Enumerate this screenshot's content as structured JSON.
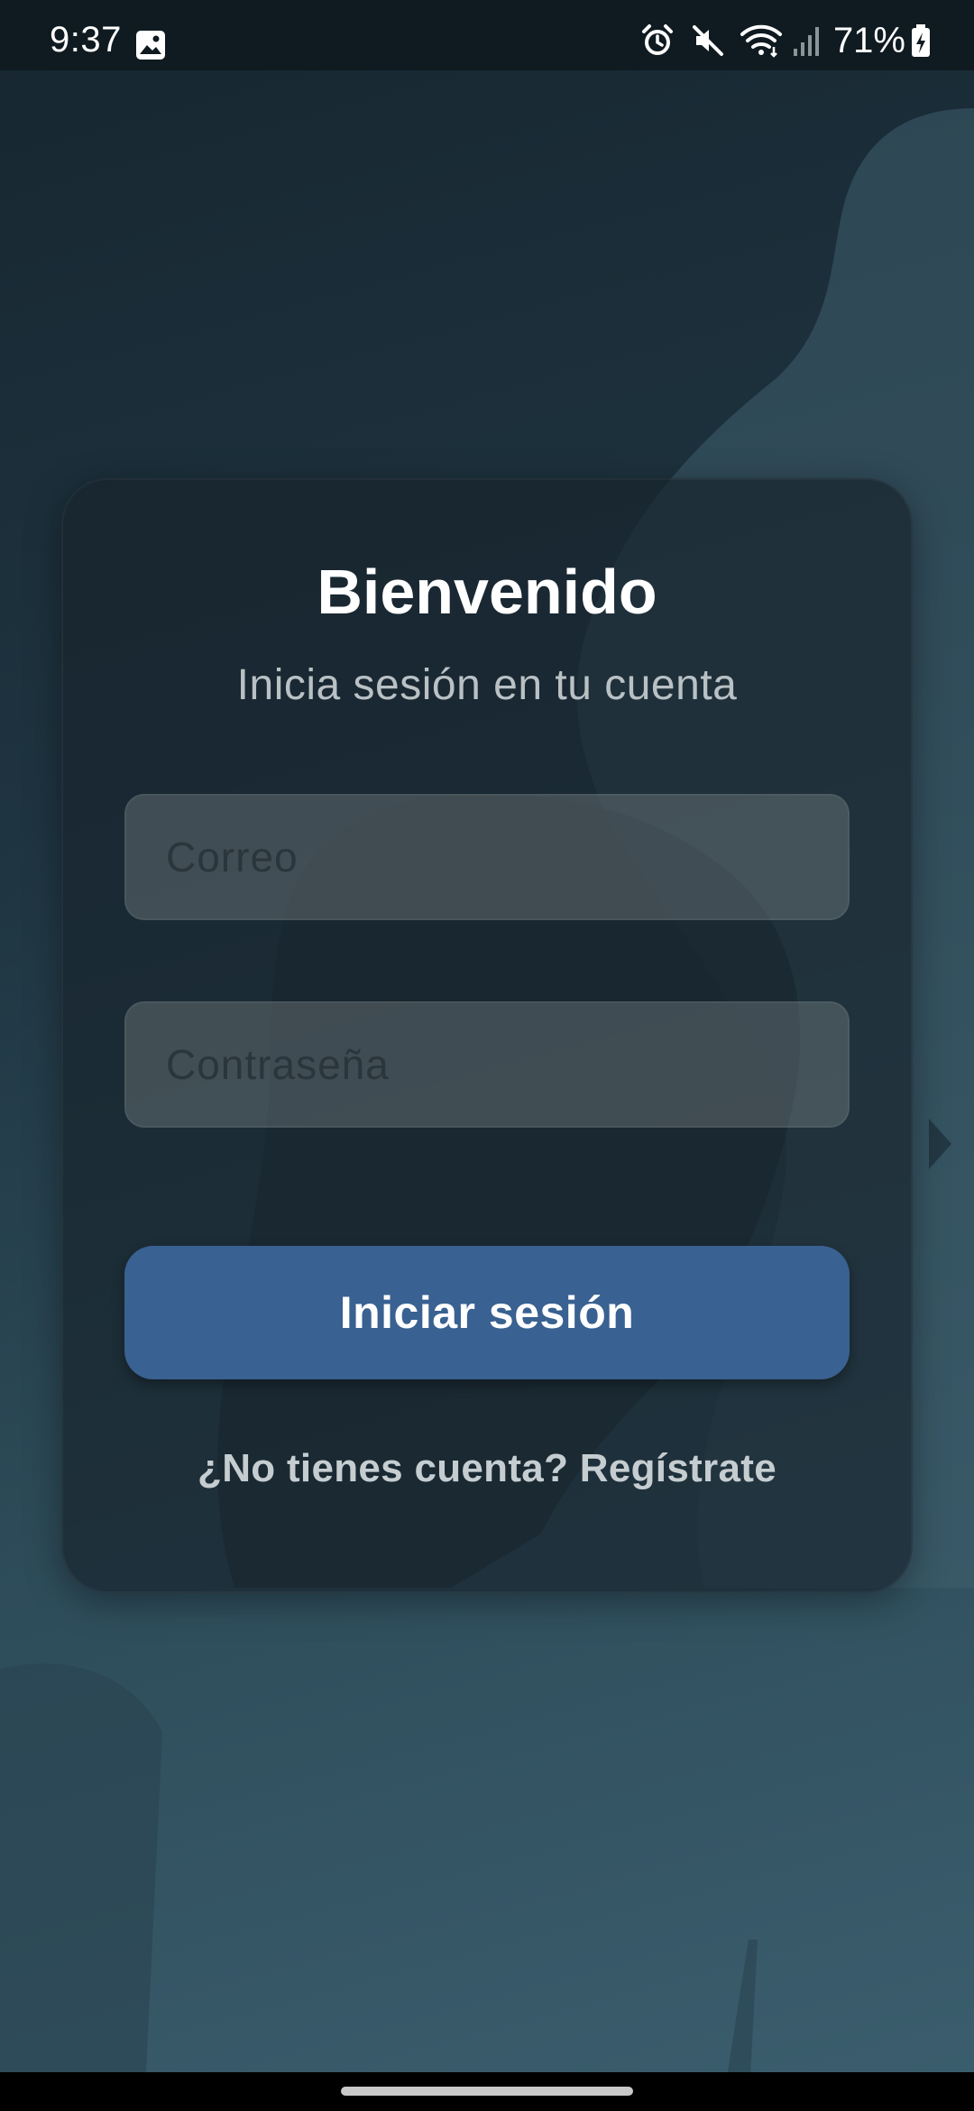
{
  "status_bar": {
    "time": "9:37",
    "battery_percent": "71%",
    "icons": [
      "gallery-icon",
      "alarm-icon",
      "mute-icon",
      "wifi-icon",
      "signal-icon",
      "battery-charging-icon"
    ]
  },
  "login": {
    "title": "Bienvenido",
    "subtitle": "Inicia sesión en tu cuenta",
    "email_placeholder": "Correo",
    "email_value": "",
    "password_placeholder": "Contraseña",
    "password_value": "",
    "submit_label": "Iniciar sesión",
    "register_text": "¿No tienes cuenta? Regístrate"
  },
  "colors": {
    "button": "#396191",
    "status_bar": "#0f1b21"
  }
}
